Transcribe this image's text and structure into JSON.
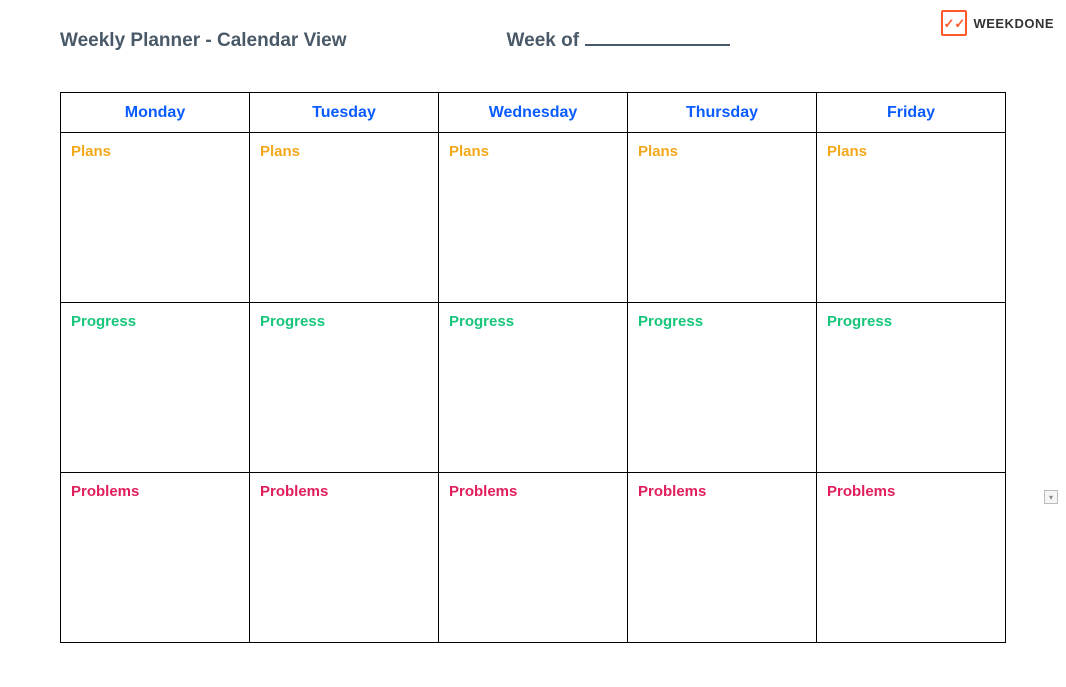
{
  "header": {
    "title": "Weekly Planner - Calendar View",
    "week_of_label": "Week of"
  },
  "logo": {
    "brand": "WEEKDONE"
  },
  "days": [
    "Monday",
    "Tuesday",
    "Wednesday",
    "Thursday",
    "Friday"
  ],
  "rows": {
    "plans_label": "Plans",
    "progress_label": "Progress",
    "problems_label": "Problems"
  },
  "colors": {
    "title": "#4a5967",
    "day_header": "#0a5cff",
    "plans": "#f3a81b",
    "progress": "#17c57b",
    "problems": "#e01e5a",
    "logo_accent": "#ff5a2b"
  }
}
